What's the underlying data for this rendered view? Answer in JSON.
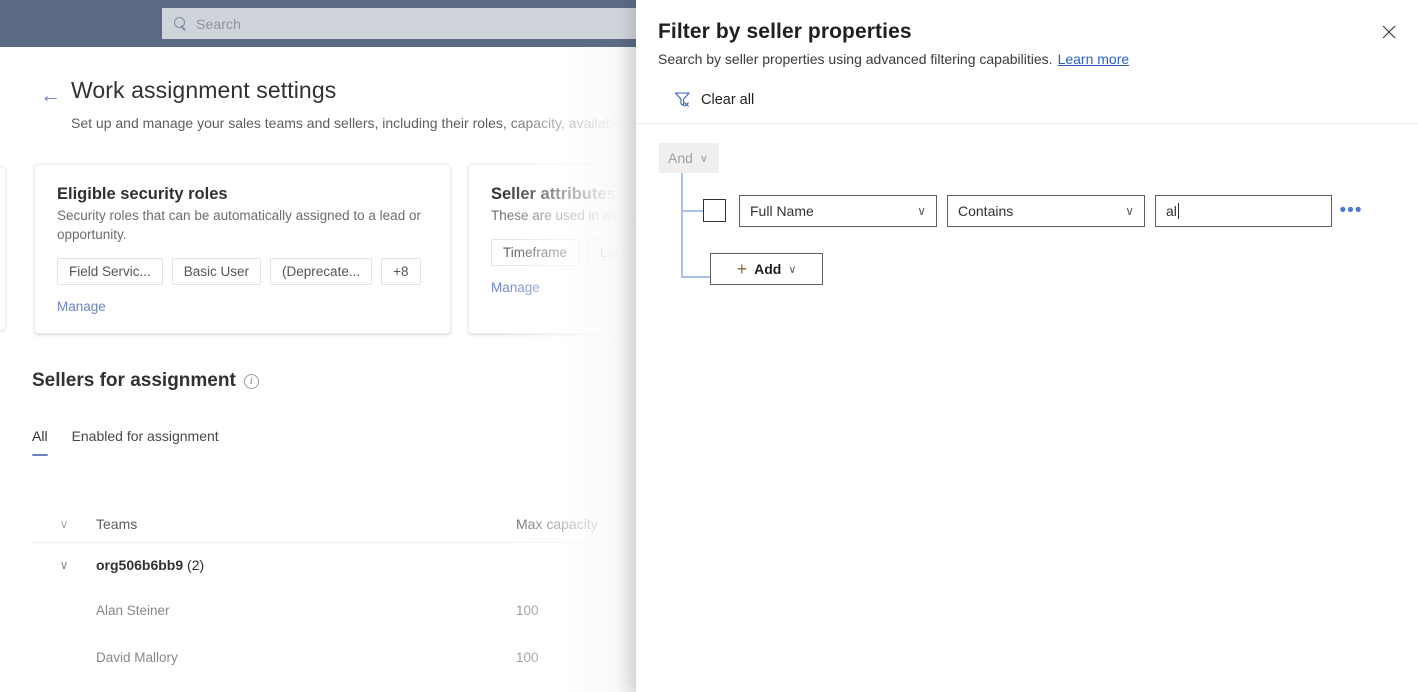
{
  "app": {
    "topbar": {
      "search": {
        "placeholder": "Search",
        "icon": "search-icon"
      }
    },
    "header": {
      "back_icon": "←",
      "title": "Work assignment settings",
      "subtitle": "Set up and manage your sales teams and sellers, including their roles, capacity, availability a"
    },
    "cards": [
      {
        "title": "Eligible security roles",
        "description": "Security roles that can be automatically assigned to a lead or opportunity.",
        "chips": [
          "Field Servic...",
          "Basic User",
          "(Deprecate...",
          "+8"
        ],
        "link": "Manage"
      },
      {
        "title": "Seller attributes",
        "description": "These are used in assign",
        "chips": [
          "Timeframe",
          "Languag"
        ],
        "link": "Manage"
      }
    ],
    "sellers": {
      "title": "Sellers for assignment",
      "info_icon": "i",
      "tabs": [
        {
          "label": "All",
          "active": true
        },
        {
          "label": "Enabled for assignment",
          "active": false
        }
      ],
      "grid": {
        "columns": [
          "Teams",
          "Max capacity"
        ],
        "expand_icon": "∨",
        "groups": [
          {
            "name": "org506b6bb9",
            "count": "(2)",
            "chevron": "∨",
            "rows": [
              {
                "name": "Alan Steiner",
                "max_capacity": "100"
              },
              {
                "name": "David Mallory",
                "max_capacity": "100"
              }
            ]
          }
        ]
      }
    }
  },
  "panel": {
    "title": "Filter by seller properties",
    "close_icon": "✕",
    "subtitle": "Search by seller properties using advanced filtering capabilities.",
    "learn_more": "Learn more",
    "clear_all": {
      "label": "Clear all",
      "icon": "funnel-clear-icon"
    },
    "group": {
      "operator": "And",
      "chevron": "∨"
    },
    "condition_row": {
      "checkbox_checked": false,
      "field": {
        "value": "Full Name",
        "chevron": "∨"
      },
      "operator": {
        "value": "Contains",
        "chevron": "∨"
      },
      "value": {
        "value": "al",
        "placeholder": ""
      },
      "more_icon": "•••"
    },
    "add_button": {
      "label": "Add",
      "plus": "+",
      "chevron": "∨"
    }
  },
  "colors": {
    "topbar": "#5c6a85",
    "accent_link": "#6b84c4",
    "panel_link": "#2b5fc4",
    "tab_underline": "#6b84c4",
    "tree_line": "#a8c0ef",
    "more_dots": "#4a7ad4"
  }
}
